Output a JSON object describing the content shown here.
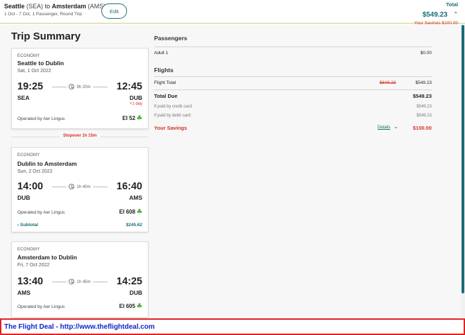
{
  "header": {
    "origin_city": "Seattle",
    "origin_code": "(SEA)",
    "to_word": "to",
    "dest_city": "Amsterdam",
    "dest_code": "(AMS)",
    "trip_meta": "1 Oct - 7 Oct, 1 Passenger, Round Trip",
    "edit_label": "Edit",
    "total_label": "Total",
    "total_amount": "$549.23",
    "savings_text": "Your Savings $100.00"
  },
  "summary": {
    "title": "Trip Summary",
    "stopover": "Stopover 1h 15m",
    "legs": [
      {
        "cabin": "ECONOMY",
        "title": "Seattle to Dublin",
        "date": "Sat, 1 Oct 2022",
        "dep_time": "19:25",
        "arr_time": "12:45",
        "duration": "9h 20m",
        "dep_airport": "SEA",
        "arr_airport": "DUB",
        "plus_day": "+1 day",
        "operated": "Operated by Aer Lingus",
        "flight_no": "EI 52"
      },
      {
        "cabin": "ECONOMY",
        "title": "Dublin to Amsterdam",
        "date": "Sun, 2 Oct 2022",
        "dep_time": "14:00",
        "arr_time": "16:40",
        "duration": "1h 40m",
        "dep_airport": "DUB",
        "arr_airport": "AMS",
        "operated": "Operated by Aer Lingus",
        "flight_no": "EI 608",
        "subtotal_label": "Subtotal",
        "subtotal_amount": "$245.62"
      },
      {
        "cabin": "ECONOMY",
        "title": "Amsterdam to Dublin",
        "date": "Fri, 7 Oct 2022",
        "dep_time": "13:40",
        "arr_time": "14:25",
        "duration": "1h 45m",
        "dep_airport": "AMS",
        "arr_airport": "DUB",
        "operated": "Operated by Aer Lingus",
        "flight_no": "EI 605"
      }
    ]
  },
  "pricing": {
    "passengers_heading": "Passengers",
    "adult_label": "Adult 1",
    "adult_amount": "$0.00",
    "flights_heading": "Flights",
    "flight_total_label": "Flight Total",
    "flight_total_old": "$649.23",
    "flight_total_new": "$549.23",
    "total_due_label": "Total Due",
    "total_due_amount": "$549.23",
    "credit_label": "If paid by credit card:",
    "credit_amount": "$549.23",
    "debit_label": "If paid by debit card:",
    "debit_amount": "$549.23",
    "savings_label": "Your Savings",
    "details_label": "Details",
    "savings_amount": "$100.00"
  },
  "footer": {
    "text": "The Flight Deal - http://www.theflightdeal.com"
  },
  "icons": {
    "chevron_up": "chevron-up-icon",
    "clock": "clock-icon",
    "shamrock": "shamrock-icon",
    "chevron_right": "chevron-right-icon",
    "chevron_down": "chevron-down-icon"
  },
  "colors": {
    "accent": "#1a6c74",
    "alert": "#d9301f",
    "brand_green": "#49a83b",
    "footer_link": "#1027c8",
    "footer_border": "#e02020"
  }
}
